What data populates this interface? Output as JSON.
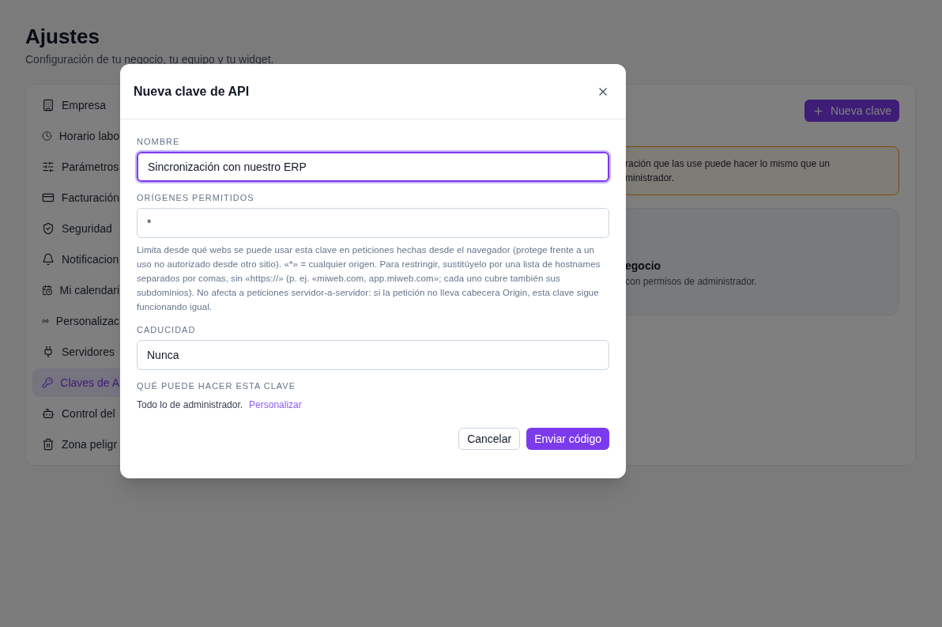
{
  "page": {
    "title": "Ajustes",
    "subtitle": "Configuración de tu negocio, tu equipo y tu widget."
  },
  "sidebar": {
    "items": [
      {
        "label": "Empresa",
        "selected": false
      },
      {
        "label": "Horario labo",
        "selected": false
      },
      {
        "label": "Parámetros",
        "selected": false
      },
      {
        "label": "Facturación",
        "selected": false
      },
      {
        "label": "Seguridad",
        "selected": false
      },
      {
        "label": "Notificacion",
        "selected": false
      },
      {
        "label": "Mi calendari",
        "selected": false
      },
      {
        "label": "Personalizac",
        "selected": false
      },
      {
        "label": "Servidores",
        "selected": false
      },
      {
        "label": "Claves de A",
        "selected": true
      },
      {
        "label": "Control del",
        "selected": false
      },
      {
        "label": "Zona peligr",
        "selected": false
      }
    ]
  },
  "content": {
    "new_key_button": "Nueva clave",
    "warning": [
      "ración que las use puede hacer lo mismo que un",
      "ministrador."
    ],
    "card": {
      "title": "egocio",
      "text": "con permisos de administrador."
    }
  },
  "dialog": {
    "title": "Nueva clave de API",
    "fields": [
      {
        "label": "NOMBRE",
        "value": "Sincronización con nuestro ERP",
        "focused": true
      },
      {
        "label": "ORÍGENES PERMITIDOS",
        "value": "*",
        "focused": false,
        "help": "Limita desde qué webs se puede usar esta clave en peticiones hechas desde el navegador (protege frente a un uso no autorizado desde otro sitio). «*» = cualquier origen. Para restringir, sustitúyelo por una lista de hostnames separados por comas, sin «https://» (p. ej. «miweb.com, app.miweb.com»; cada uno cubre también sus subdominios). No afecta a peticiones servidor-a-servidor: si la petición no lleva cabecera Origin, esta clave sigue funcionando igual."
      },
      {
        "label": "CADUCIDAD",
        "value": "Nunca",
        "focused": false
      }
    ],
    "permissions": {
      "label": "QUÉ PUEDE HACER ESTA CLAVE",
      "text": "Todo lo de administrador.",
      "link": "Personalizar"
    },
    "buttons": {
      "cancel": "Cancelar",
      "submit": "Enviar código"
    }
  }
}
